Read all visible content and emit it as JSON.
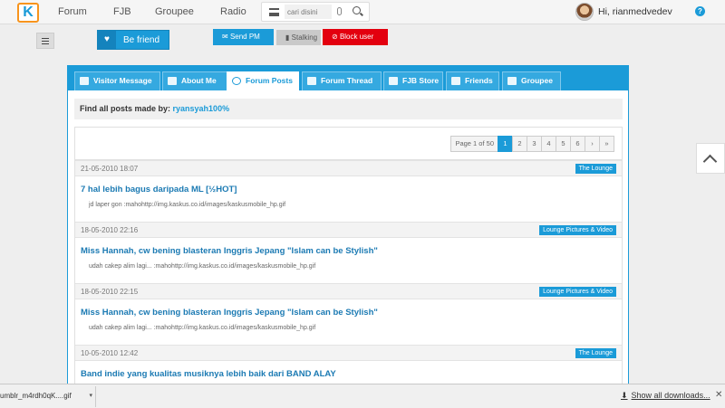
{
  "topbar": {
    "logo": "K",
    "nav": [
      "Forum",
      "FJB",
      "Groupee",
      "Radio"
    ],
    "search_placeholder": "cari disini",
    "username": "Hi, rianmedvedev",
    "help": "?"
  },
  "profile_actions": {
    "befriend": "Be friend",
    "send_pm": "Send PM",
    "stalking": "Stalking",
    "block_user": "Block user"
  },
  "tabs": [
    "Visitor Message",
    "About Me",
    "Forum Posts",
    "Forum Thread",
    "FJB Store",
    "Friends",
    "Groupee"
  ],
  "find": {
    "label": "Find all posts made by:",
    "user": "ryansyah100%"
  },
  "pager": {
    "info": "Page 1 of 50",
    "pages": [
      "1",
      "2",
      "3",
      "4",
      "5",
      "6"
    ],
    "next": "›",
    "last": "»"
  },
  "posts": [
    {
      "date": "21-05-2010 18:07",
      "category": "The Lounge",
      "title": "7 hal lebih bagus daripada ML [½HOT]",
      "snippet": "jd laper gon :mahohttp://img.kaskus.co.id/images/kaskusmobile_hp.gif"
    },
    {
      "date": "18-05-2010 22:16",
      "category": "Lounge Pictures & Video",
      "title": "Miss Hannah, cw bening blasteran Inggris Jepang \"Islam can be Stylish\"",
      "snippet": "udah cakep alim lagi... :mahohttp://img.kaskus.co.id/images/kaskusmobile_hp.gif"
    },
    {
      "date": "18-05-2010 22:15",
      "category": "Lounge Pictures & Video",
      "title": "Miss Hannah, cw bening blasteran Inggris Jepang \"Islam can be Stylish\"",
      "snippet": "udah cakep alim lagi... :mahohttp://img.kaskus.co.id/images/kaskusmobile_hp.gif"
    },
    {
      "date": "10-05-2010 12:42",
      "category": "The Lounge",
      "title": "Band indie yang kualitas musiknya lebih baik dari BAND ALAY",
      "snippet": ""
    }
  ],
  "downloads": {
    "file": "umblr_m4rdh0qK....gif",
    "show_all": "Show all downloads..."
  },
  "colors": {
    "brand": "#1b9bd8",
    "block": "#e3000f",
    "logo_border": "#f7941d"
  }
}
